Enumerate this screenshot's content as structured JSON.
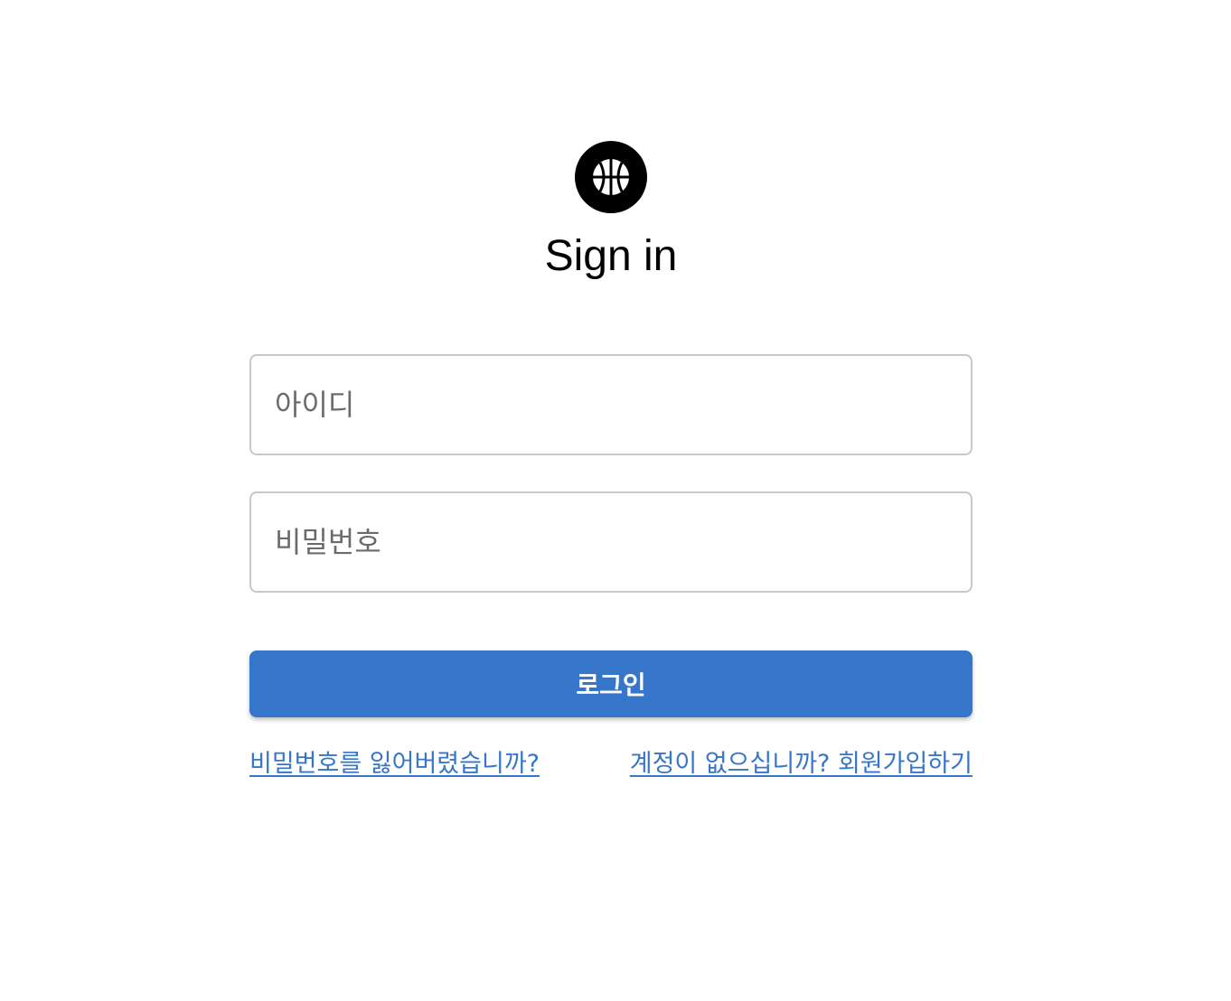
{
  "brand": {
    "logo_icon": "basketball-icon",
    "colors": {
      "accent": "#3576cb",
      "logo_bg": "#000000",
      "border": "#c8c8c8"
    }
  },
  "header": {
    "title": "Sign in"
  },
  "form": {
    "username": {
      "value": "",
      "placeholder": "아이디"
    },
    "password": {
      "value": "",
      "placeholder": "비밀번호"
    },
    "submit_label": "로그인"
  },
  "links": {
    "forgot_password": "비밀번호를 잃어버렸습니까?",
    "sign_up": "계정이 없으십니까? 회원가입하기"
  }
}
